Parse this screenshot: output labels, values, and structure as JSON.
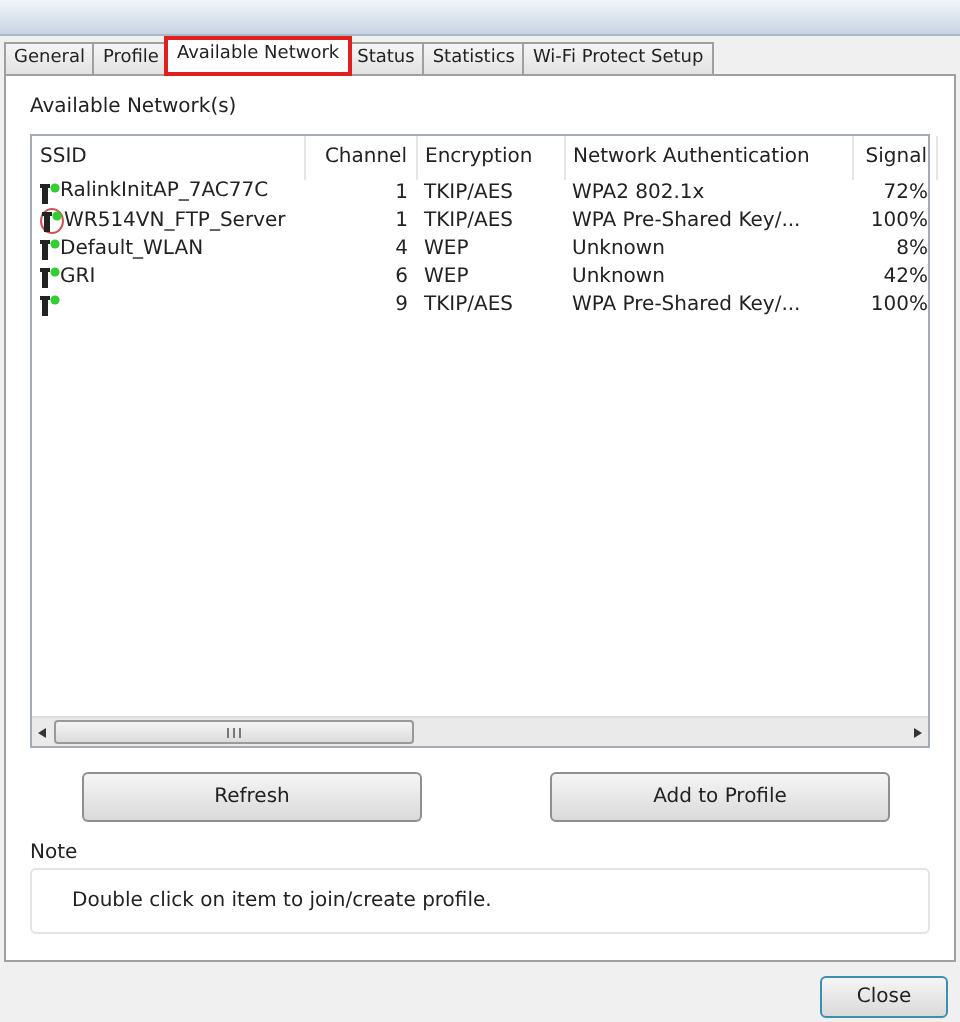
{
  "tabs": [
    {
      "label": "General",
      "selected": false,
      "highlighted": false
    },
    {
      "label": "Profile",
      "selected": false,
      "highlighted": false
    },
    {
      "label": "Available Network",
      "selected": true,
      "highlighted": true
    },
    {
      "label": "Status",
      "selected": false,
      "highlighted": false
    },
    {
      "label": "Statistics",
      "selected": false,
      "highlighted": false
    },
    {
      "label": "Wi-Fi Protect Setup",
      "selected": false,
      "highlighted": false
    }
  ],
  "section_title": "Available Network(s)",
  "table": {
    "columns": [
      "SSID",
      "Channel",
      "Encryption",
      "Network Authentication",
      "Signal"
    ],
    "rows": [
      {
        "ssid": "RalinkInitAP_7AC77C",
        "channel": "1",
        "encryption": "TKIP/AES",
        "authentication": "WPA2 802.1x",
        "signal": "72%",
        "connected": false
      },
      {
        "ssid": "WR514VN_FTP_Server",
        "channel": "1",
        "encryption": "TKIP/AES",
        "authentication": "WPA Pre-Shared Key/...",
        "signal": "100%",
        "connected": true
      },
      {
        "ssid": "Default_WLAN",
        "channel": "4",
        "encryption": "WEP",
        "authentication": "Unknown",
        "signal": "8%",
        "connected": false
      },
      {
        "ssid": "GRI",
        "channel": "6",
        "encryption": "WEP",
        "authentication": "Unknown",
        "signal": "42%",
        "connected": false
      },
      {
        "ssid": "",
        "channel": "9",
        "encryption": "TKIP/AES",
        "authentication": "WPA Pre-Shared Key/...",
        "signal": "100%",
        "connected": false
      }
    ]
  },
  "buttons": [
    "Refresh",
    "Add to Profile"
  ],
  "note": {
    "title": "Note",
    "text": "Double click on item to join/create profile."
  },
  "footer_buttons": [
    "Close"
  ]
}
